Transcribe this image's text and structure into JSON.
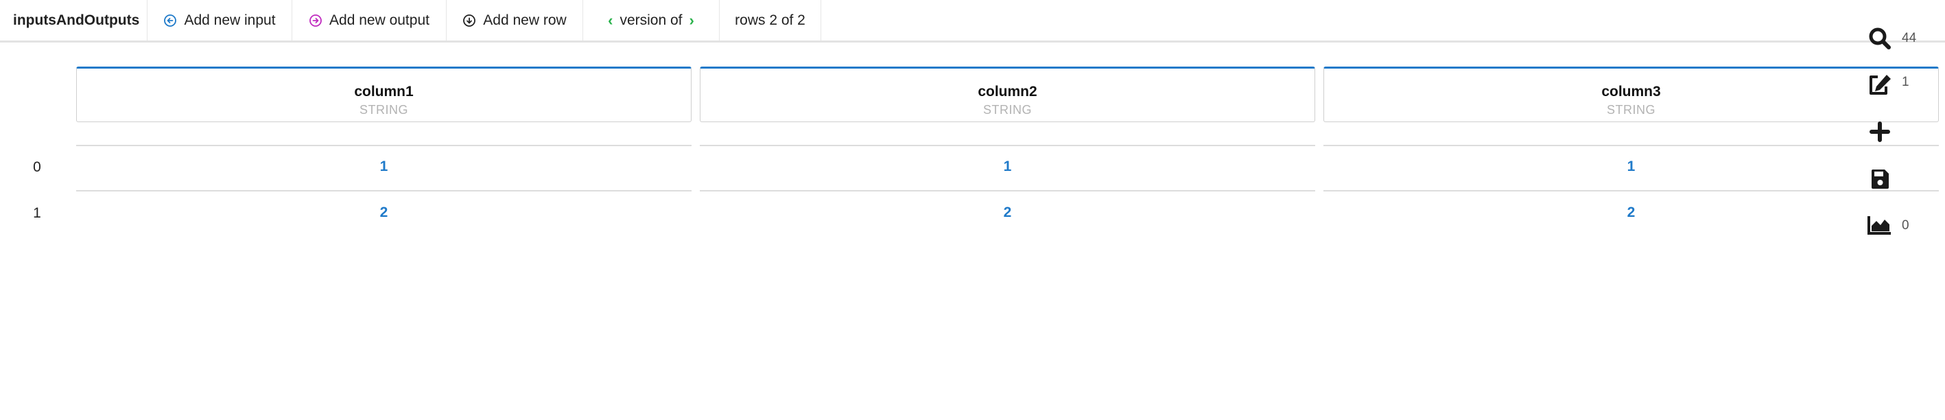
{
  "toolbar": {
    "title": "inputsAndOutputs",
    "add_input_label": "Add new input",
    "add_output_label": "Add new output",
    "add_row_label": "Add new row",
    "version_label": "version of",
    "rows_label": "rows 2 of 2"
  },
  "columns": [
    {
      "name": "column1",
      "type": "STRING"
    },
    {
      "name": "column2",
      "type": "STRING"
    },
    {
      "name": "column3",
      "type": "STRING"
    }
  ],
  "rows": [
    {
      "index": "0",
      "cells": [
        "1",
        "1",
        "1"
      ]
    },
    {
      "index": "1",
      "cells": [
        "2",
        "2",
        "2"
      ]
    }
  ],
  "side_tools": {
    "search_count": "44",
    "edit_count": "1",
    "chart_count": "0"
  },
  "icons": {
    "add_input": "arrow-left-circle-icon",
    "add_output": "arrow-right-circle-icon",
    "add_row": "arrow-down-circle-icon",
    "search": "search-icon",
    "edit": "edit-icon",
    "add": "plus-icon",
    "save": "save-icon",
    "chart": "area-chart-icon"
  },
  "colors": {
    "accent_blue": "#1f7ac9",
    "input_icon": "#1f7ac9",
    "output_icon": "#c02bbf",
    "version_arrows": "#2bb24c"
  }
}
